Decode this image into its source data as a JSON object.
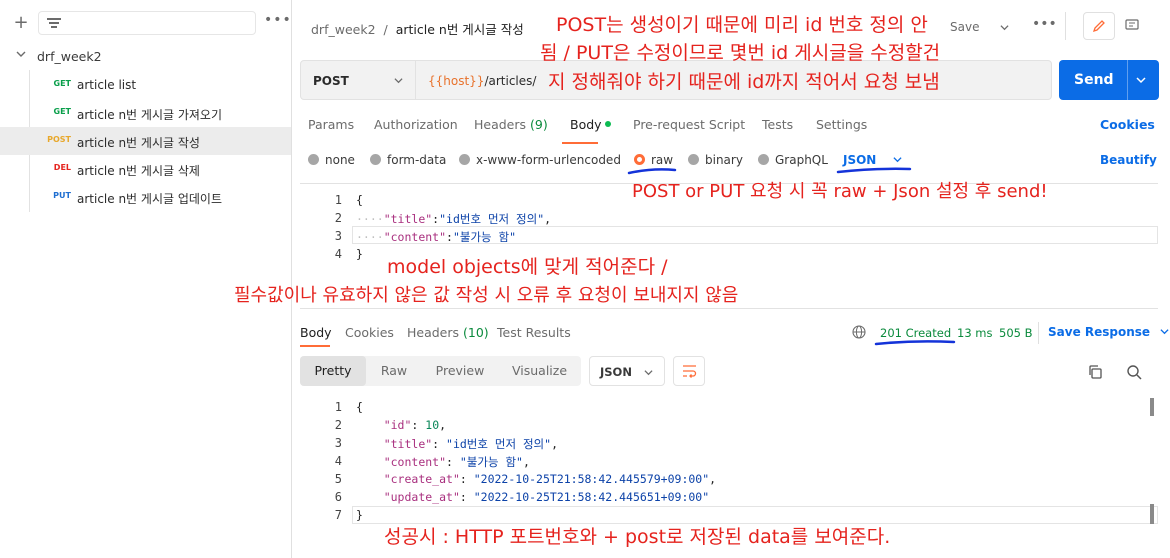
{
  "sidebar": {
    "collection": "drf_week2",
    "requests": [
      {
        "method": "GET",
        "method_color": "#0a9f4b",
        "name": "article list",
        "active": false
      },
      {
        "method": "GET",
        "method_color": "#0a9f4b",
        "name": "article n번 게시글 가져오기",
        "active": false
      },
      {
        "method": "POST",
        "method_color": "#e8a82c",
        "name": "article n번 게시글 작성",
        "active": true
      },
      {
        "method": "DEL",
        "method_color": "#e5231e",
        "name": "article n번 게시글 삭제",
        "active": false
      },
      {
        "method": "PUT",
        "method_color": "#1f6fd1",
        "name": "article n번 게시글 업데이트",
        "active": false
      }
    ]
  },
  "header": {
    "breadcrumb_collection": "drf_week2",
    "breadcrumb_sep": "/",
    "breadcrumb_request": "article n번 게시글 작성",
    "save_label": "Save",
    "more": "•••"
  },
  "request": {
    "method": "POST",
    "url_var": "{{host}}",
    "url_path": "/articles/",
    "send_label": "Send"
  },
  "request_tabs": {
    "params": "Params",
    "authorization": "Authorization",
    "headers": "Headers",
    "headers_count": "(9)",
    "body": "Body",
    "prerequest": "Pre-request Script",
    "tests": "Tests",
    "settings": "Settings",
    "cookies": "Cookies"
  },
  "body_types": {
    "none": "none",
    "form_data": "form-data",
    "urlencoded": "x-www-form-urlencoded",
    "raw": "raw",
    "binary": "binary",
    "graphql": "GraphQL",
    "format": "JSON",
    "beautify": "Beautify"
  },
  "request_body": {
    "line_numbers": [
      "1",
      "2",
      "3",
      "4"
    ],
    "open": "{",
    "title_key": "\"title\"",
    "title_val": "\"id번호 먼저 정의\"",
    "content_key": "\"content\"",
    "content_val": "\"불가능 함\"",
    "close": "}"
  },
  "response": {
    "tab_body": "Body",
    "tab_cookies": "Cookies",
    "tab_headers": "Headers",
    "headers_count": "(10)",
    "tab_tests": "Test Results",
    "status": "201 Created",
    "time": "13 ms",
    "size": "505 B",
    "save_response": "Save Response",
    "view_pretty": "Pretty",
    "view_raw": "Raw",
    "view_preview": "Preview",
    "view_visualize": "Visualize",
    "format": "JSON",
    "line_numbers": [
      "1",
      "2",
      "3",
      "4",
      "5",
      "6",
      "7"
    ],
    "open": "{",
    "id_key": "\"id\"",
    "id_val": "10",
    "title_key": "\"title\"",
    "title_val": "\"id번호 먼저 정의\"",
    "content_key": "\"content\"",
    "content_val": "\"불가능 함\"",
    "create_key": "\"create_at\"",
    "create_val": "\"2022-10-25T21:58:42.445579+09:00\"",
    "update_key": "\"update_at\"",
    "update_val": "\"2022-10-25T21:58:42.445651+09:00\"",
    "close": "}"
  },
  "annotations": {
    "top_line1": "POST는 생성이기 때문에 미리 id 번호 정의 안",
    "top_line2": "됨 / PUT은 수정이므로 몇번 id 게시글을 수정할건",
    "top_line3": "지 정해줘야 하기 때문에 id까지 적어서 요청 보냄",
    "raw_json": "POST or PUT 요청 시 꼭 raw + Json 설정 후 send!",
    "model_line1": "model objects에 맞게 적어준다 /",
    "model_line2": "필수값이나 유효하지 않은 값 작성 시 오류 후 요청이 보내지지 않음",
    "success": "성공시 : HTTP 포트번호와 + post로 저장된 data를 보여준다."
  },
  "colors": {
    "accent": "#ff6c37",
    "primary": "#0b6ce6",
    "annotation": "#e5231e",
    "success": "#0a8a3c"
  }
}
